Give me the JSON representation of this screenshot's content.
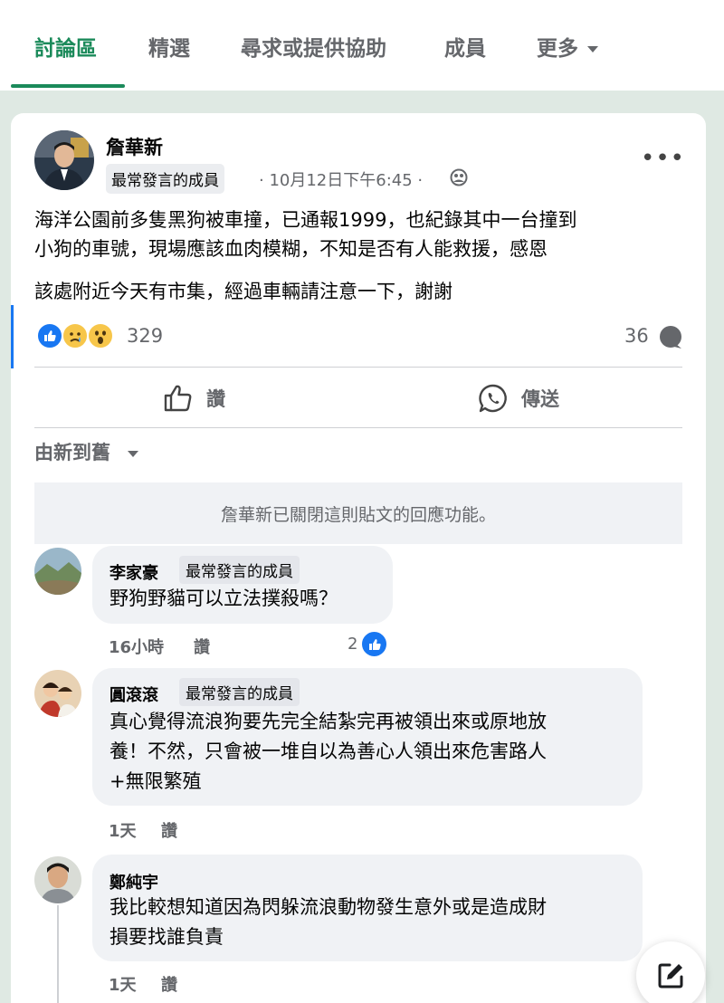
{
  "tabs": [
    {
      "label": "討論區",
      "active": true
    },
    {
      "label": "精選"
    },
    {
      "label": "尋求或提供協助"
    },
    {
      "label": "成員"
    },
    {
      "label": "更多"
    }
  ],
  "post": {
    "author": "詹華新",
    "badge": "最常發言的成員",
    "meta": "· 10月12日下午6:45 ·",
    "text_lines": [
      "海洋公園前多隻黑狗被車撞，已通報1999，也紀錄其中一台撞到",
      "小狗的車號，現場應該血肉模糊，不知是否有人能救援，感恩",
      "該處附近今天有市集，經過車輛請注意一下，謝謝"
    ],
    "reaction_count": "329",
    "comment_count": "36",
    "like_label": "讚",
    "send_label": "傳送",
    "sort_label": "由新到舊",
    "closed_notice": "詹華新已關閉這則貼文的回應功能。"
  },
  "comments": [
    {
      "name": "李家豪",
      "badge": "最常發言的成員",
      "lines": [
        "野狗野貓可以立法撲殺嗎？"
      ],
      "time": "16小時",
      "like": "讚",
      "reactions": "2"
    },
    {
      "name": "圓滾滾",
      "badge": "最常發言的成員",
      "lines": [
        "真心覺得流浪狗要先完全結紮完再被領出來或原地放",
        "養！不然，只會被一堆自以為善心人領出來危害路人",
        "+無限繁殖"
      ],
      "time": "1天",
      "like": "讚"
    },
    {
      "name": "鄭純宇",
      "lines": [
        "我比較想知道因為閃躲流浪動物發生意外或是造成財",
        "損要找誰負責"
      ],
      "time": "1天",
      "like": "讚"
    }
  ],
  "colors": {
    "accent": "#1b8a5a",
    "like_blue": "#1877f2",
    "background": "#dfe9e3"
  }
}
